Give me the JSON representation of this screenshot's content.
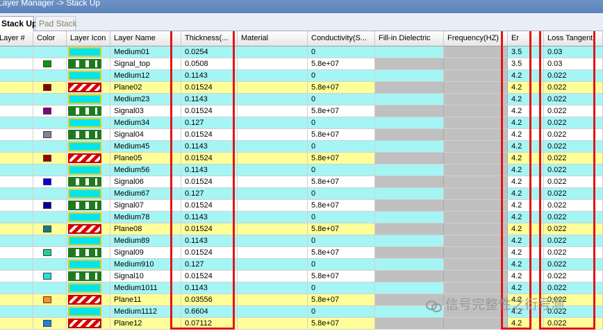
{
  "window": {
    "title": "Layer Manager -> Stack Up"
  },
  "tabs": [
    {
      "label": "Stack Up",
      "active": true
    },
    {
      "label": "Pad Stack",
      "active": false
    }
  ],
  "columns": {
    "layer_num": "Layer #",
    "color": "Color",
    "layer_icon": "Layer Icon",
    "layer_name": "Layer Name",
    "thickness": "Thickness(...",
    "material": "Material",
    "conductivity": "Conductivity(S...",
    "fill_in": "Fill-in Dielectric",
    "frequency": "Frequency(HZ)",
    "er": "Er",
    "loss_tangent": "Loss Tangent"
  },
  "rows": [
    {
      "name": "Medium01",
      "kind": "dielectric",
      "color": "",
      "thickness": "0.0254",
      "conductivity": "0",
      "er": "3.5",
      "loss": "0.03"
    },
    {
      "name": "Signal_top",
      "kind": "signal",
      "color": "#00a000",
      "thickness": "0.0508",
      "conductivity": "5.8e+07",
      "er": "3.5",
      "loss": "0.03"
    },
    {
      "name": "Medium12",
      "kind": "dielectric",
      "color": "",
      "thickness": "0.1143",
      "conductivity": "0",
      "er": "4.2",
      "loss": "0.022"
    },
    {
      "name": "Plane02",
      "kind": "plane",
      "color": "#8b0000",
      "thickness": "0.01524",
      "conductivity": "5.8e+07",
      "er": "4.2",
      "loss": "0.022"
    },
    {
      "name": "Medium23",
      "kind": "dielectric",
      "color": "",
      "thickness": "0.1143",
      "conductivity": "0",
      "er": "4.2",
      "loss": "0.022"
    },
    {
      "name": "Signal03",
      "kind": "signal",
      "color": "#800080",
      "thickness": "0.01524",
      "conductivity": "5.8e+07",
      "er": "4.2",
      "loss": "0.022"
    },
    {
      "name": "Medium34",
      "kind": "dielectric",
      "color": "",
      "thickness": "0.127",
      "conductivity": "0",
      "er": "4.2",
      "loss": "0.022"
    },
    {
      "name": "Signal04",
      "kind": "signal",
      "color": "#8080a0",
      "thickness": "0.01524",
      "conductivity": "5.8e+07",
      "er": "4.2",
      "loss": "0.022"
    },
    {
      "name": "Medium45",
      "kind": "dielectric",
      "color": "",
      "thickness": "0.1143",
      "conductivity": "0",
      "er": "4.2",
      "loss": "0.022"
    },
    {
      "name": "Plane05",
      "kind": "plane",
      "color": "#a00000",
      "thickness": "0.01524",
      "conductivity": "5.8e+07",
      "er": "4.2",
      "loss": "0.022"
    },
    {
      "name": "Medium56",
      "kind": "dielectric",
      "color": "",
      "thickness": "0.1143",
      "conductivity": "0",
      "er": "4.2",
      "loss": "0.022"
    },
    {
      "name": "Signal06",
      "kind": "signal",
      "color": "#0000e0",
      "thickness": "0.01524",
      "conductivity": "5.8e+07",
      "er": "4.2",
      "loss": "0.022"
    },
    {
      "name": "Medium67",
      "kind": "dielectric",
      "color": "",
      "thickness": "0.127",
      "conductivity": "0",
      "er": "4.2",
      "loss": "0.022"
    },
    {
      "name": "Signal07",
      "kind": "signal",
      "color": "#0000a0",
      "thickness": "0.01524",
      "conductivity": "5.8e+07",
      "er": "4.2",
      "loss": "0.022"
    },
    {
      "name": "Medium78",
      "kind": "dielectric",
      "color": "",
      "thickness": "0.1143",
      "conductivity": "0",
      "er": "4.2",
      "loss": "0.022"
    },
    {
      "name": "Plane08",
      "kind": "plane",
      "color": "#108080",
      "thickness": "0.01524",
      "conductivity": "5.8e+07",
      "er": "4.2",
      "loss": "0.022"
    },
    {
      "name": "Medium89",
      "kind": "dielectric",
      "color": "",
      "thickness": "0.1143",
      "conductivity": "0",
      "er": "4.2",
      "loss": "0.022"
    },
    {
      "name": "Signal09",
      "kind": "signal",
      "color": "#20d090",
      "thickness": "0.01524",
      "conductivity": "5.8e+07",
      "er": "4.2",
      "loss": "0.022"
    },
    {
      "name": "Medium910",
      "kind": "dielectric",
      "color": "",
      "thickness": "0.127",
      "conductivity": "0",
      "er": "4.2",
      "loss": "0.022"
    },
    {
      "name": "Signal10",
      "kind": "signal",
      "color": "#20e0e0",
      "thickness": "0.01524",
      "conductivity": "5.8e+07",
      "er": "4.2",
      "loss": "0.022"
    },
    {
      "name": "Medium1011",
      "kind": "dielectric",
      "color": "",
      "thickness": "0.1143",
      "conductivity": "0",
      "er": "4.2",
      "loss": "0.022"
    },
    {
      "name": "Plane11",
      "kind": "plane",
      "color": "#ff9020",
      "thickness": "0.03556",
      "conductivity": "5.8e+07",
      "er": "4.2",
      "loss": "0.022"
    },
    {
      "name": "Medium1112",
      "kind": "dielectric",
      "color": "",
      "thickness": "0.6604",
      "conductivity": "0",
      "er": "4.2",
      "loss": "0.022"
    },
    {
      "name": "Plane12",
      "kind": "plane",
      "color": "#2080e0",
      "thickness": "0.07112",
      "conductivity": "5.8e+07",
      "er": "4.2",
      "loss": "0.022"
    }
  ],
  "row_colors": {
    "dielectric": "#a6f5f5",
    "signal": "#ffffff",
    "plane": "#ffff99"
  },
  "watermark": {
    "text": "信号完整性之衍号测"
  }
}
